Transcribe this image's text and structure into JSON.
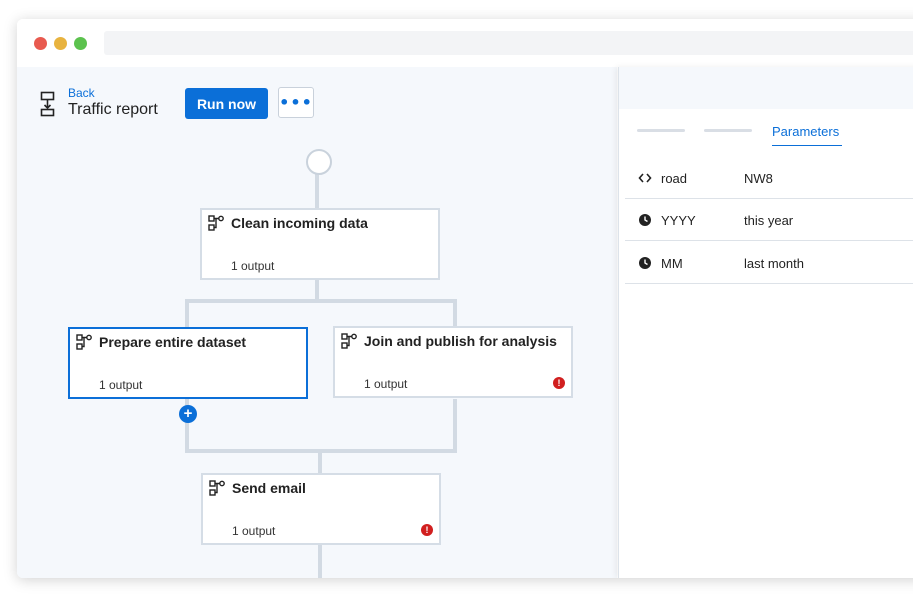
{
  "header": {
    "back_label": "Back",
    "title": "Traffic report",
    "run_label": "Run now",
    "more_label": "•••"
  },
  "flow": {
    "nodes": [
      {
        "title": "Clean incoming data",
        "output": "1 output",
        "error": false
      },
      {
        "title": "Prepare entire dataset",
        "output": "1 output",
        "error": false,
        "selected": true
      },
      {
        "title": "Join and publish for analysis",
        "output": "1 output",
        "error": true
      },
      {
        "title": "Send email",
        "output": "1 output",
        "error": true
      }
    ],
    "add_label": "+",
    "error_glyph": "!"
  },
  "panel": {
    "active_tab": "Parameters",
    "params": [
      {
        "icon": "code-icon",
        "name": "road",
        "value": "NW8"
      },
      {
        "icon": "clock-icon",
        "name": "YYYY",
        "value": "this year"
      },
      {
        "icon": "clock-icon",
        "name": "MM",
        "value": "last month"
      }
    ]
  },
  "colors": {
    "accent": "#0b6fd8",
    "error": "#d11f1f",
    "connector": "#d2dae3"
  }
}
